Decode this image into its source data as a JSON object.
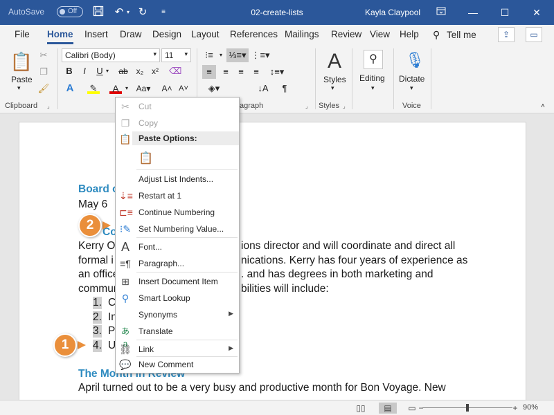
{
  "titlebar": {
    "autosave_label": "AutoSave",
    "autosave_state": "Off",
    "doc_title": "02-create-lists",
    "user": "Kayla Claypool",
    "icons": [
      "save-icon",
      "undo-icon",
      "redo-icon",
      "customize-qat-icon",
      "ribbon-display-icon",
      "minimize-icon",
      "maximize-icon",
      "close-icon"
    ]
  },
  "tabs": {
    "items": [
      "File",
      "Home",
      "Insert",
      "Draw",
      "Design",
      "Layout",
      "References",
      "Mailings",
      "Review",
      "View",
      "Help"
    ],
    "active": "Home",
    "tell_me": "Tell me"
  },
  "ribbon": {
    "paste_label": "Paste",
    "font_name": "Calibri (Body)",
    "font_size": "11",
    "styles_label": "Styles",
    "editing_label": "Editing",
    "dictate_label": "Dictate",
    "groups": {
      "clipboard": "Clipboard",
      "paragraph": "agraph",
      "styles": "Styles",
      "voice": "Voice"
    },
    "format_buttons": [
      "B",
      "I",
      "U",
      "ab",
      "x₂",
      "x²"
    ]
  },
  "document": {
    "lines": [
      {
        "text": "Board o",
        "style": "heading"
      },
      {
        "text": "May 6",
        "style": "body"
      },
      {
        "text": "Co",
        "style": "heading"
      },
      {
        "text": "Kerry Ol",
        "style": "body"
      },
      {
        "text": "formal i",
        "style": "body"
      },
      {
        "text": "an office",
        "style": "body"
      },
      {
        "text": "commun",
        "style": "body"
      }
    ],
    "right_fragments": [
      "ions director and will coordinate and direct all",
      "nications. Kerry has four years of experience as",
      ". and has degrees in both marketing and",
      "bilities will include:"
    ],
    "list_items": [
      {
        "num": "1.",
        "text": "Cl"
      },
      {
        "num": "2.",
        "text": "In"
      },
      {
        "num": "3.",
        "text": "Pr"
      },
      {
        "num": "4.",
        "text": "U"
      }
    ],
    "section_heading": "The Month in Review",
    "section_body": "April turned out to be a very busy and productive month for Bon Voyage. New"
  },
  "context_menu": {
    "cut": "Cut",
    "copy": "Copy",
    "paste_options": "Paste Options:",
    "adjust": "Adjust List Indents...",
    "restart": "Restart at 1",
    "continue": "Continue Numbering",
    "set_value": "Set Numbering Value...",
    "font": "Font...",
    "paragraph": "Paragraph...",
    "insert_doc": "Insert Document Item",
    "smart_lookup": "Smart Lookup",
    "synonyms": "Synonyms",
    "translate": "Translate",
    "link": "Link",
    "new_comment": "New Comment"
  },
  "callouts": {
    "one": "1",
    "two": "2"
  },
  "statusbar": {
    "zoom": "90%",
    "zoom_fraction": 0.5
  },
  "colors": {
    "brand": "#2b579a",
    "heading": "#2e8bc0",
    "callout": "#ea8f3b"
  }
}
